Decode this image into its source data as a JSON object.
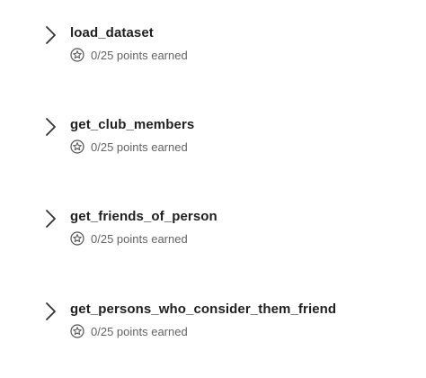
{
  "tasks": [
    {
      "title": "load_dataset",
      "points": "0/25 points earned",
      "chevron_icon": "chevron-right-icon",
      "points_icon": "star-badge-icon"
    },
    {
      "title": "get_club_members",
      "points": "0/25 points earned",
      "chevron_icon": "chevron-right-icon",
      "points_icon": "star-badge-icon"
    },
    {
      "title": "get_friends_of_person",
      "points": "0/25 points earned",
      "chevron_icon": "chevron-right-icon",
      "points_icon": "star-badge-icon"
    },
    {
      "title": "get_persons_who_consider_them_friend",
      "points": "0/25 points earned",
      "chevron_icon": "chevron-right-icon",
      "points_icon": "star-badge-icon"
    }
  ],
  "colors": {
    "title": "#1f1f1f",
    "subtle_text": "#636363",
    "icon": "#555555",
    "background": "#ffffff"
  }
}
